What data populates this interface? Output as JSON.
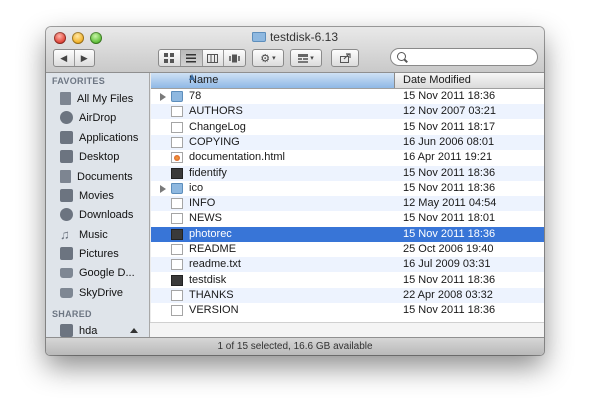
{
  "window": {
    "title": "testdisk-6.13"
  },
  "toolbar": {
    "back_forward": [
      "◀",
      "▶"
    ],
    "view_modes": [
      "icon-view-icon",
      "list-view-icon",
      "column-view-icon",
      "coverflow-view-icon"
    ],
    "action_icon": "gear-icon",
    "arrange_icon": "arrange-icon",
    "share_icon": "share-icon",
    "search_placeholder": ""
  },
  "sidebar": {
    "favorites_header": "FAVORITES",
    "favorites": [
      {
        "label": "All My Files",
        "icon": "all-files-icon"
      },
      {
        "label": "AirDrop",
        "icon": "airdrop-icon"
      },
      {
        "label": "Applications",
        "icon": "applications-icon"
      },
      {
        "label": "Desktop",
        "icon": "desktop-icon"
      },
      {
        "label": "Documents",
        "icon": "documents-icon"
      },
      {
        "label": "Movies",
        "icon": "movies-icon"
      },
      {
        "label": "Downloads",
        "icon": "downloads-icon"
      },
      {
        "label": "Music",
        "icon": "music-icon"
      },
      {
        "label": "Pictures",
        "icon": "pictures-icon"
      },
      {
        "label": "Google D...",
        "icon": "folder-icon"
      },
      {
        "label": "SkyDrive",
        "icon": "folder-icon"
      }
    ],
    "shared_header": "SHARED",
    "shared": [
      {
        "label": "hda",
        "icon": "drive-icon"
      }
    ]
  },
  "list": {
    "columns": {
      "name": "Name",
      "date": "Date Modified"
    },
    "rows": [
      {
        "name": "78",
        "date": "15 Nov 2011 18:36",
        "kind": "folder",
        "expandable": true
      },
      {
        "name": "AUTHORS",
        "date": "12 Nov 2007 03:21",
        "kind": "doc"
      },
      {
        "name": "ChangeLog",
        "date": "15 Nov 2011 18:17",
        "kind": "doc"
      },
      {
        "name": "COPYING",
        "date": "16 Jun 2006 08:01",
        "kind": "doc"
      },
      {
        "name": "documentation.html",
        "date": "16 Apr 2011 19:21",
        "kind": "html"
      },
      {
        "name": "fidentify",
        "date": "15 Nov 2011 18:36",
        "kind": "exec"
      },
      {
        "name": "ico",
        "date": "15 Nov 2011 18:36",
        "kind": "folder",
        "expandable": true
      },
      {
        "name": "INFO",
        "date": "12 May 2011 04:54",
        "kind": "doc"
      },
      {
        "name": "NEWS",
        "date": "15 Nov 2011 18:01",
        "kind": "doc"
      },
      {
        "name": "photorec",
        "date": "15 Nov 2011 18:36",
        "kind": "exec",
        "selected": true
      },
      {
        "name": "README",
        "date": "25 Oct 2006 19:40",
        "kind": "doc"
      },
      {
        "name": "readme.txt",
        "date": "16 Jul 2009 03:31",
        "kind": "doc"
      },
      {
        "name": "testdisk",
        "date": "15 Nov 2011 18:36",
        "kind": "exec"
      },
      {
        "name": "THANKS",
        "date": "22 Apr 2008 03:32",
        "kind": "doc"
      },
      {
        "name": "VERSION",
        "date": "15 Nov 2011 18:36",
        "kind": "doc"
      }
    ]
  },
  "status": {
    "text": "1 of 15 selected, 16.6 GB available"
  },
  "colors": {
    "selection": "#3875d7",
    "stripe": "#edf3fe",
    "sidebar_bg": "#dfe4ea"
  }
}
